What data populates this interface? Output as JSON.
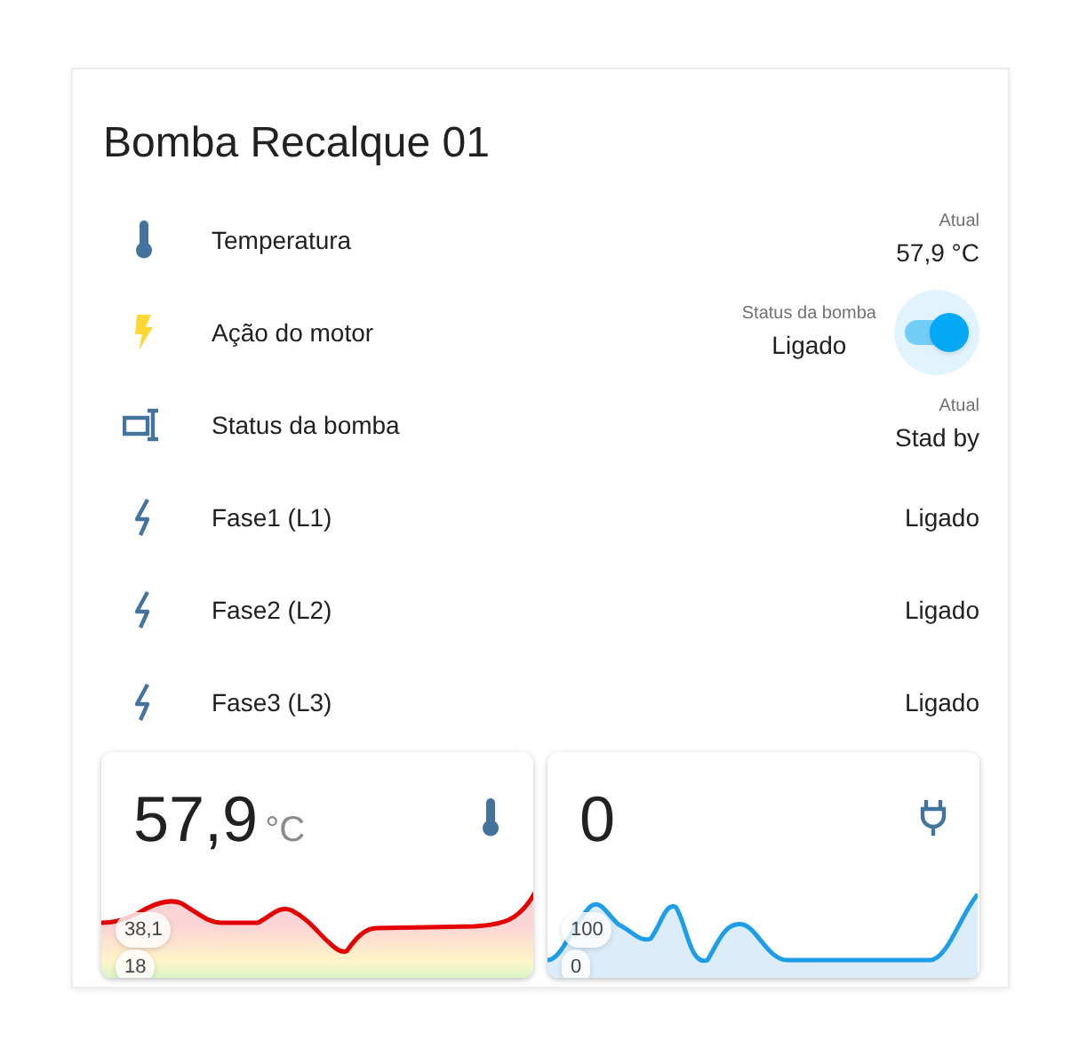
{
  "card": {
    "title": "Bomba Recalque 01"
  },
  "rows": [
    {
      "kind": "value",
      "name": "Temperatura",
      "caption": "Atual",
      "value": "57,9 °C"
    },
    {
      "kind": "toggle",
      "name": "Ação do motor",
      "caption": "Status da bomba",
      "value": "Ligado",
      "on": true
    },
    {
      "kind": "value",
      "name": "Status da bomba",
      "caption": "Atual",
      "value": "Stad by"
    },
    {
      "kind": "value",
      "name": "Fase1 (L1)",
      "value": "Ligado"
    },
    {
      "kind": "value",
      "name": "Fase2 (L2)",
      "value": "Ligado"
    },
    {
      "kind": "value",
      "name": "Fase3 (L3)",
      "value": "Ligado"
    }
  ],
  "graphs": [
    {
      "kind": "temperature",
      "value": "57,9",
      "unit": "°C",
      "max_label": "38,1",
      "min_label": "18"
    },
    {
      "kind": "power",
      "value": "0",
      "max_label": "100",
      "min_label": "0"
    }
  ]
}
